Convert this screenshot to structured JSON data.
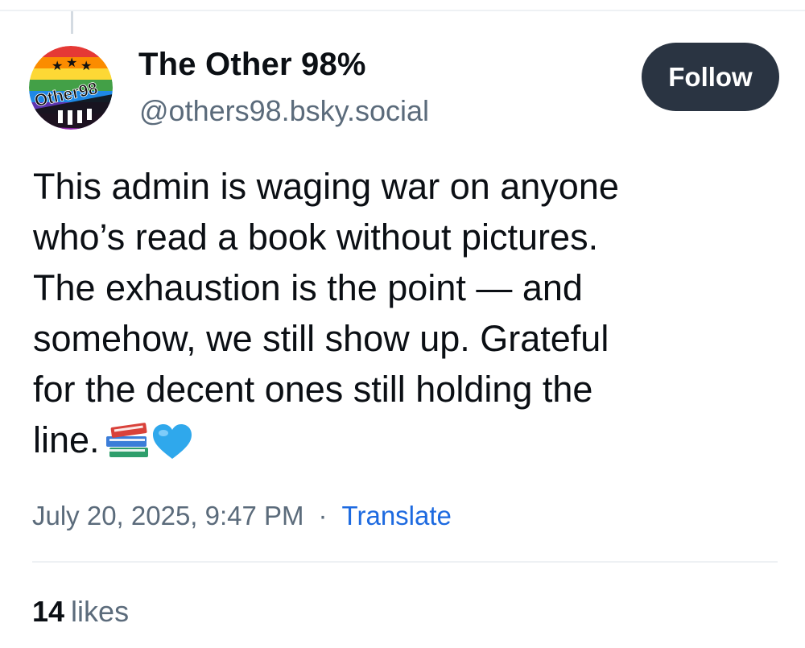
{
  "author": {
    "display_name": "The Other 98%",
    "handle": "@others98.bsky.social",
    "avatar_text": "Other98"
  },
  "follow_label": "Follow",
  "post": {
    "text": "This admin is waging war on anyone\nwho’s read a book without pictures.\nThe exhaustion is the point — and\nsomehow, we still show up. Grateful\nfor the decent ones still holding the\nline.",
    "emojis": [
      "books-icon",
      "blue-heart-icon"
    ]
  },
  "meta": {
    "timestamp": "July 20, 2025, 9:47 PM",
    "separator": "·",
    "translate_label": "Translate"
  },
  "stats": {
    "likes_count": "14",
    "likes_label": "likes"
  },
  "colors": {
    "follow_bg": "#2a3442",
    "link": "#1d6ae0",
    "muted": "#5b6b7b"
  }
}
